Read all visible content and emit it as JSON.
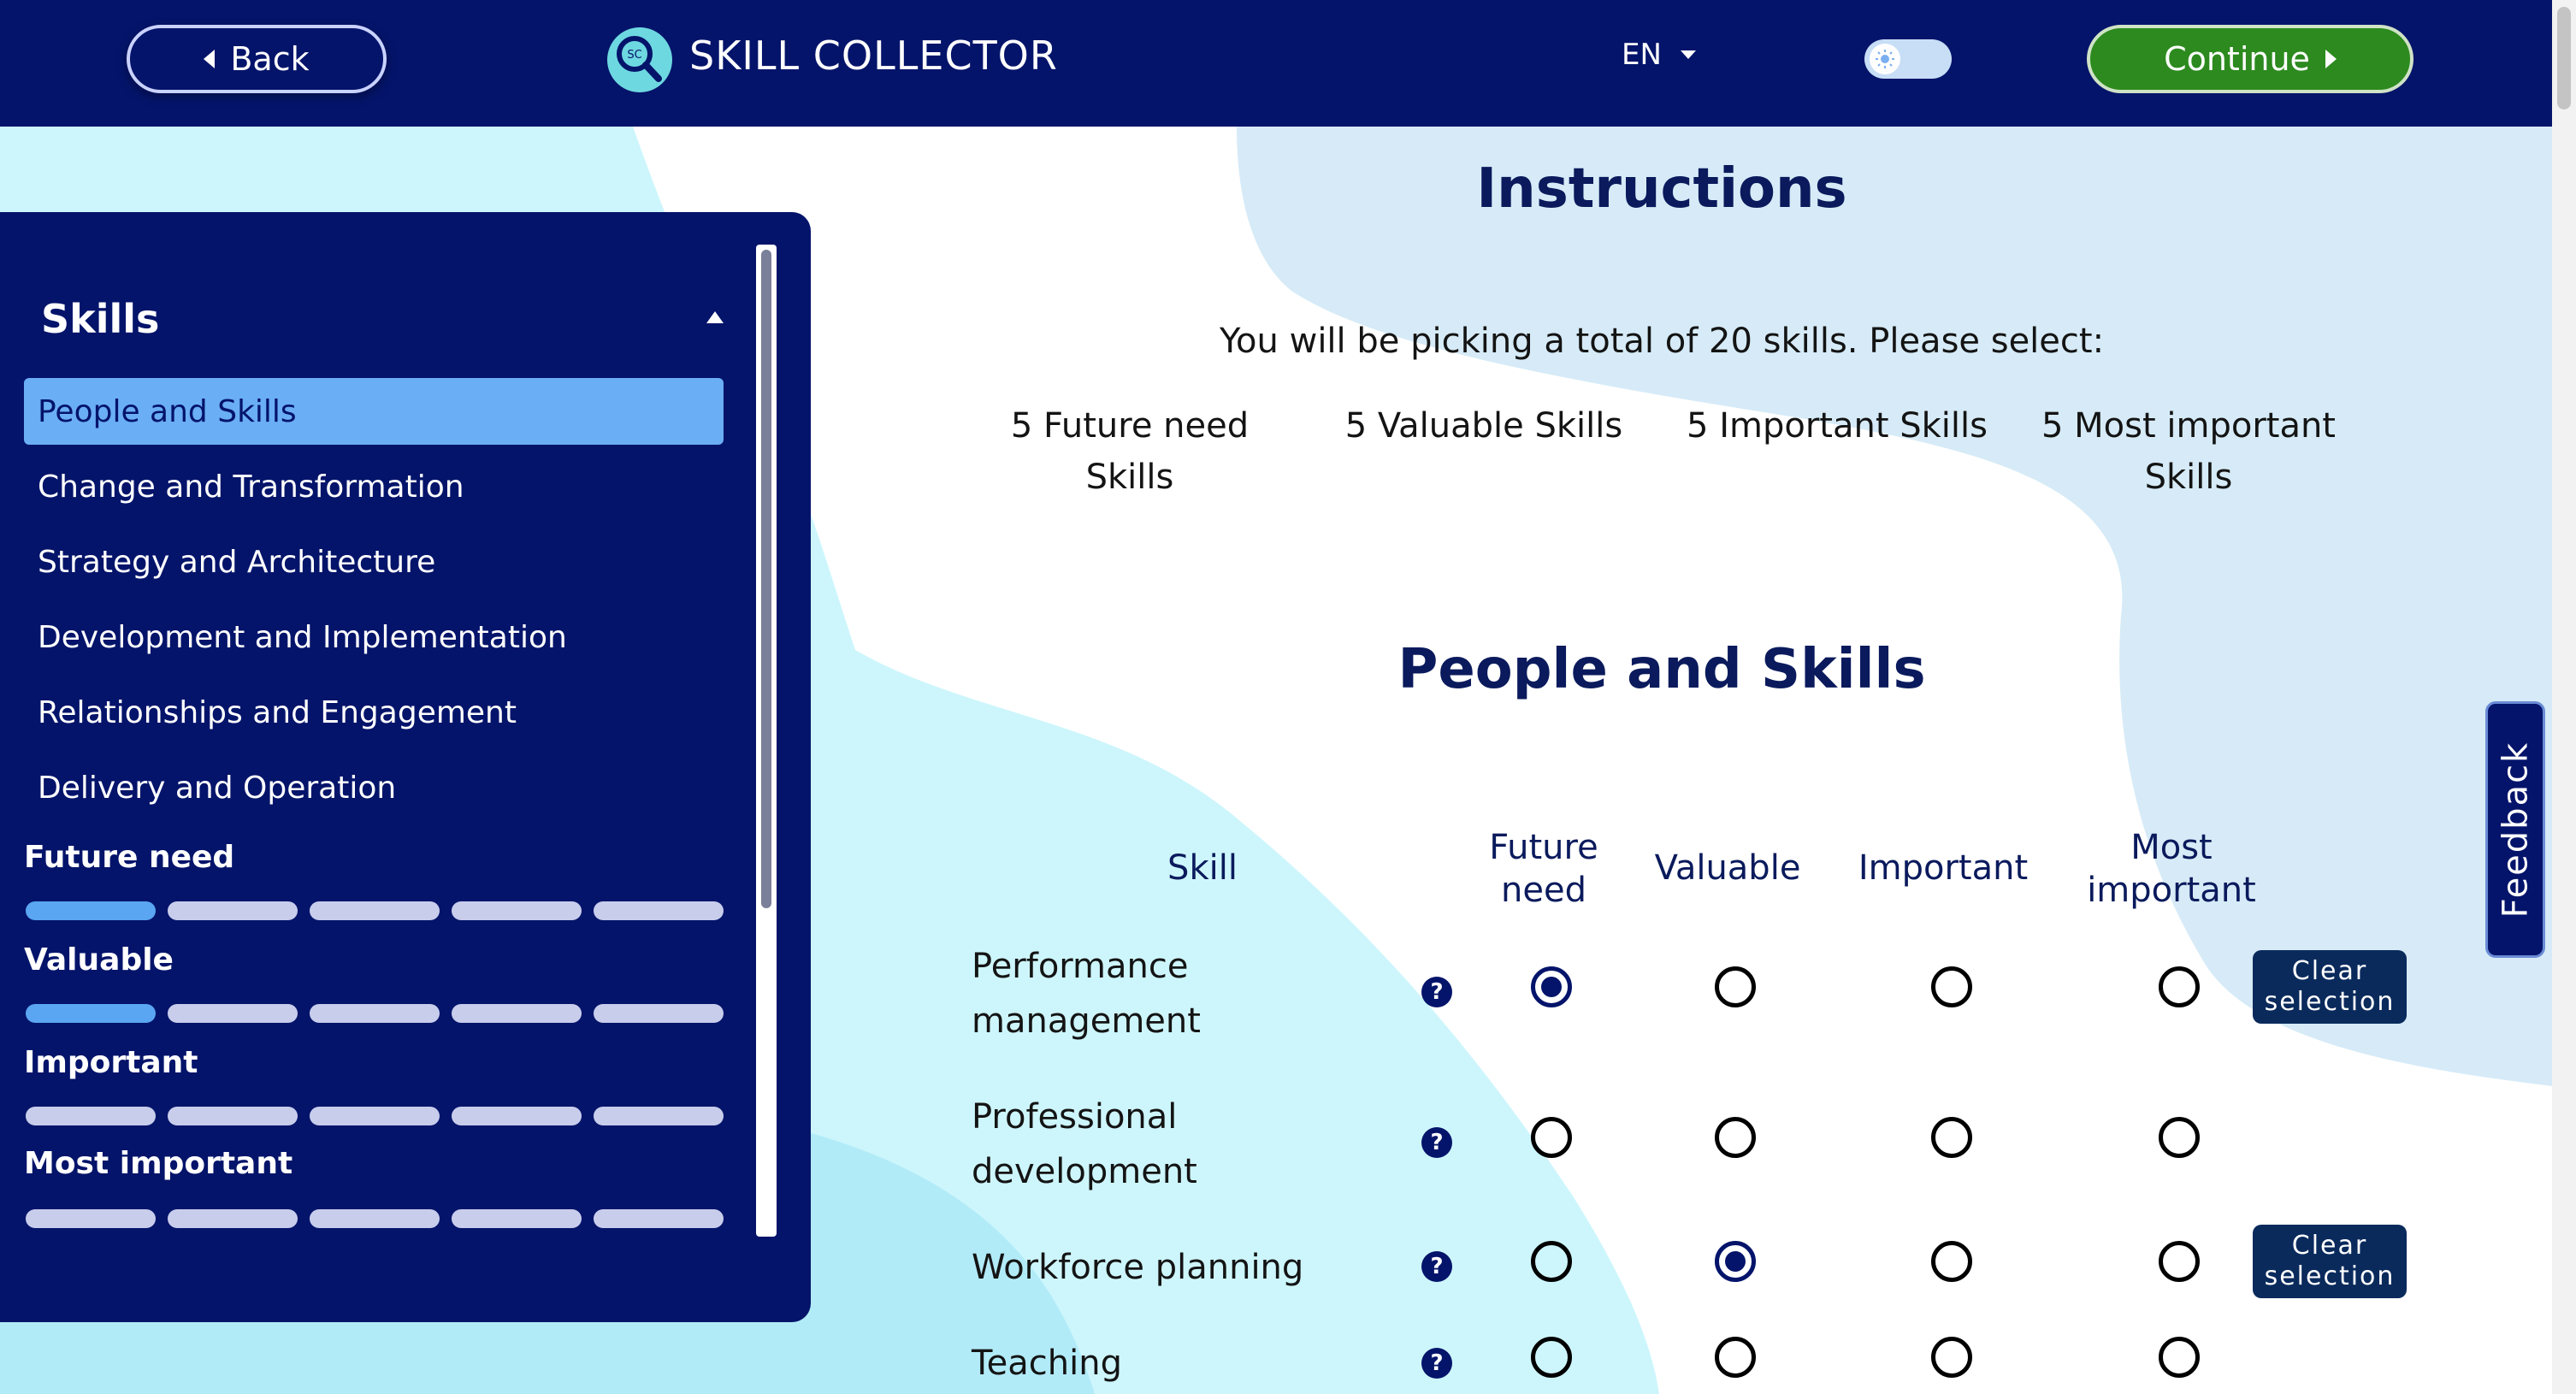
{
  "header": {
    "back_label": "Back",
    "app_title": "SKILL COLLECTOR",
    "logo_text": "SC",
    "language": "EN",
    "continue_label": "Continue"
  },
  "sidebar": {
    "title": "Skills",
    "categories": [
      {
        "label": "People and Skills",
        "active": true
      },
      {
        "label": "Change and Transformation",
        "active": false
      },
      {
        "label": "Strategy and Architecture",
        "active": false
      },
      {
        "label": "Development and Implementation",
        "active": false
      },
      {
        "label": "Relationships and Engagement",
        "active": false
      },
      {
        "label": "Delivery and Operation",
        "active": false
      }
    ],
    "progress": [
      {
        "label": "Future need",
        "selected": 1,
        "total": 5
      },
      {
        "label": "Valuable",
        "selected": 1,
        "total": 5
      },
      {
        "label": "Important",
        "selected": 0,
        "total": 5
      },
      {
        "label": "Most important",
        "selected": 0,
        "total": 5
      }
    ]
  },
  "instructions": {
    "title": "Instructions",
    "text": "You will be picking a total of 20 skills. Please select:",
    "options": [
      "5 Future need Skills",
      "5 Valuable Skills",
      "5 Important Skills",
      "5 Most important Skills"
    ]
  },
  "section": {
    "title": "People and Skills",
    "columns": {
      "skill": "Skill",
      "future_need": "Future need",
      "valuable": "Valuable",
      "important": "Important",
      "most_important": "Most important"
    },
    "clear_label": "Clear selection",
    "help_glyph": "?",
    "rows": [
      {
        "skill": "Performance management",
        "selected": "future_need"
      },
      {
        "skill": "Professional development",
        "selected": null
      },
      {
        "skill": "Workforce planning",
        "selected": "valuable"
      },
      {
        "skill": "Teaching",
        "selected": null
      }
    ]
  },
  "feedback_label": "Feedback",
  "colors": {
    "navy": "#04146a",
    "accent_blue": "#6aaef5",
    "continue_green": "#2c8a1e",
    "bg_light_blue": "#d4eaf6",
    "bg_cyan": "#cdf6fc"
  }
}
